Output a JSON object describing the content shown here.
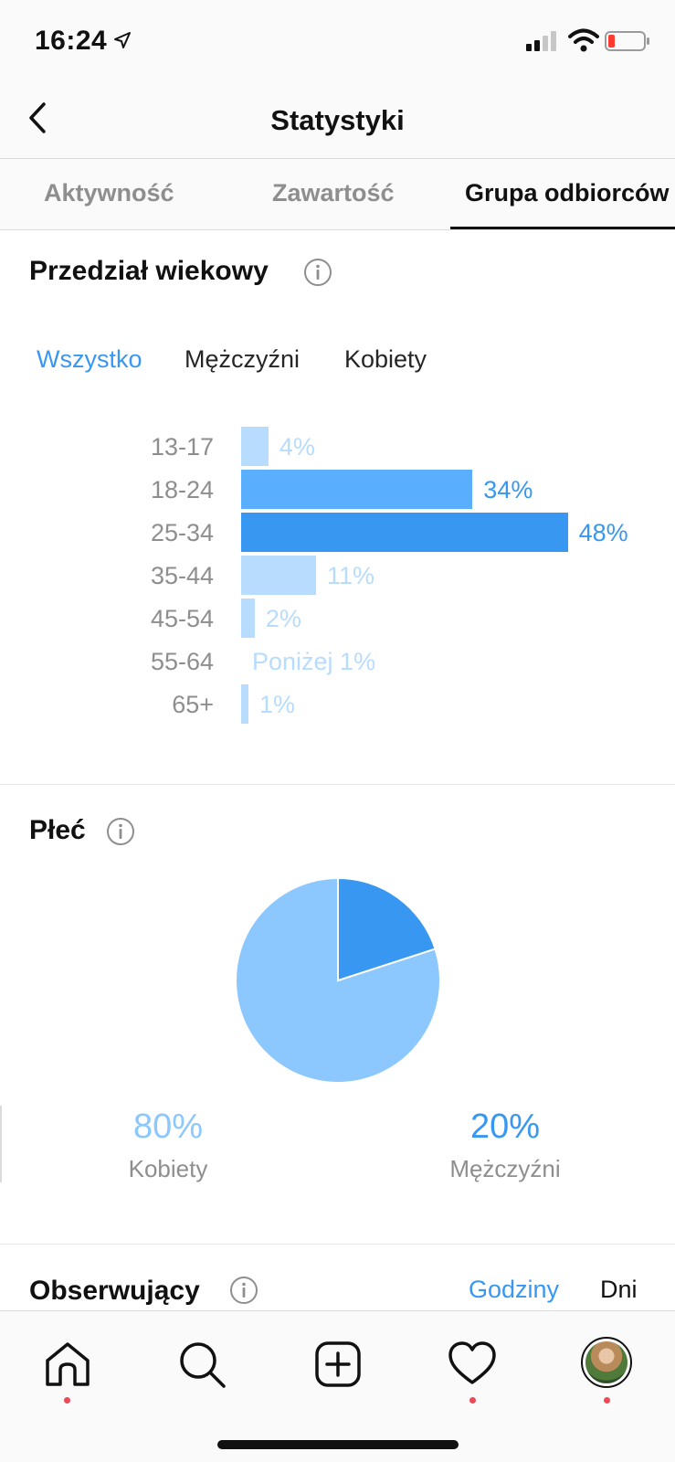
{
  "status_bar": {
    "time": "16:24"
  },
  "header": {
    "title": "Statystyki"
  },
  "tabs": [
    {
      "label": "Aktywność",
      "active": false
    },
    {
      "label": "Zawartość",
      "active": false
    },
    {
      "label": "Grupa odbiorców",
      "active": true
    }
  ],
  "age_section": {
    "title": "Przedział wiekowy",
    "filters": [
      {
        "label": "Wszystko",
        "active": true
      },
      {
        "label": "Mężczyźni",
        "active": false
      },
      {
        "label": "Kobiety",
        "active": false
      }
    ],
    "rows": [
      {
        "label": "13-17",
        "value_text": "4%",
        "percent": 4
      },
      {
        "label": "18-24",
        "value_text": "34%",
        "percent": 34
      },
      {
        "label": "25-34",
        "value_text": "48%",
        "percent": 48
      },
      {
        "label": "35-44",
        "value_text": "11%",
        "percent": 11
      },
      {
        "label": "45-54",
        "value_text": "2%",
        "percent": 2
      },
      {
        "label": "55-64",
        "value_text": "Poniżej 1%",
        "percent": 0
      },
      {
        "label": "65+",
        "value_text": "1%",
        "percent": 1
      }
    ]
  },
  "gender_section": {
    "title": "Płeć",
    "women": {
      "percent_text": "80%",
      "label": "Kobiety",
      "percent": 80
    },
    "men": {
      "percent_text": "20%",
      "label": "Mężczyźni",
      "percent": 20
    }
  },
  "followers_section": {
    "title": "Obserwujący",
    "periods": [
      {
        "label": "Godziny",
        "active": true
      },
      {
        "label": "Dni",
        "active": false
      }
    ]
  },
  "colors": {
    "accent": "#3897f0",
    "bar_light": "#b8dcfe",
    "bar_mid": "#5aaefe",
    "bar_dark": "#3897f0",
    "pie_women": "#8cc7fd",
    "pie_men": "#3897f0",
    "notification_dot": "#ed4956"
  },
  "chart_data": [
    {
      "type": "bar",
      "title": "Przedział wiekowy",
      "categories": [
        "13-17",
        "18-24",
        "25-34",
        "35-44",
        "45-54",
        "55-64",
        "65+"
      ],
      "values": [
        4,
        34,
        48,
        11,
        2,
        0.5,
        1
      ],
      "value_labels": [
        "4%",
        "34%",
        "48%",
        "11%",
        "2%",
        "Poniżej 1%",
        "1%"
      ],
      "orientation": "horizontal"
    },
    {
      "type": "pie",
      "title": "Płeć",
      "categories": [
        "Kobiety",
        "Mężczyźni"
      ],
      "values": [
        80,
        20
      ]
    }
  ],
  "bottom_nav": {
    "items": [
      {
        "icon": "home-icon",
        "has_dot": true
      },
      {
        "icon": "search-icon",
        "has_dot": false
      },
      {
        "icon": "plus-square-icon",
        "has_dot": false
      },
      {
        "icon": "heart-icon",
        "has_dot": true
      },
      {
        "icon": "profile-avatar",
        "has_dot": true
      }
    ]
  }
}
